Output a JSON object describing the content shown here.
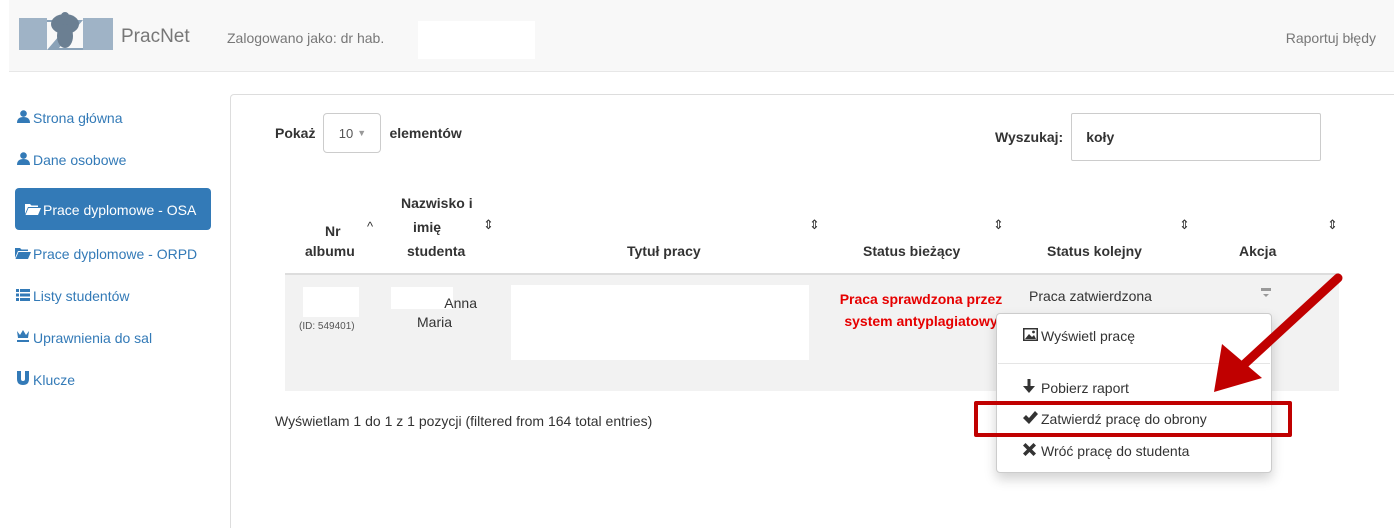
{
  "navbar": {
    "brand": "PracNet",
    "logged_in_label": "Zalogowano jako: dr hab.",
    "report_bugs": "Raportuj błędy"
  },
  "sidebar": {
    "items": [
      {
        "label": "Strona główna",
        "icon": "user-icon"
      },
      {
        "label": "Dane osobowe",
        "icon": "user-icon"
      },
      {
        "label": "Prace dyplomowe - OSA",
        "icon": "folder-open-icon",
        "active": true
      },
      {
        "label": "Prace dyplomowe - ORPD",
        "icon": "folder-open-icon"
      },
      {
        "label": "Listy studentów",
        "icon": "list-icon"
      },
      {
        "label": "Uprawnienia do sal",
        "icon": "throne-icon"
      },
      {
        "label": "Klucze",
        "icon": "magnet-icon"
      }
    ]
  },
  "table_controls": {
    "show_label": "Pokaż",
    "page_size": "10",
    "elements_label": "elementów",
    "search_label": "Wyszukaj:",
    "search_value": "koły"
  },
  "table": {
    "headers": {
      "album_line1": "Nr",
      "album_line2": "albumu",
      "name_line1": "Nazwisko i",
      "name_line2": "imię",
      "name_line3": "studenta",
      "title": "Tytuł pracy",
      "status_current": "Status bieżący",
      "status_next": "Status kolejny",
      "action": "Akcja"
    },
    "rows": [
      {
        "id": "(ID: 549401)",
        "first_name": "Anna",
        "second_name": "Maria",
        "status_current": "Praca sprawdzona przez system antyplagiatowy",
        "status_next": "Praca zatwierdzona"
      }
    ]
  },
  "info": "Wyświetlam 1 do 1 z 1 pozycji (filtered from 164 total entries)",
  "dropdown": {
    "view": "Wyświetl pracę",
    "download_report": "Pobierz raport",
    "approve": "Zatwierdź pracę do obrony",
    "return": "Wróć pracę do studenta"
  },
  "colors": {
    "primary": "#337ab7",
    "status_red": "#e60000",
    "annotation_red": "#c00000"
  }
}
